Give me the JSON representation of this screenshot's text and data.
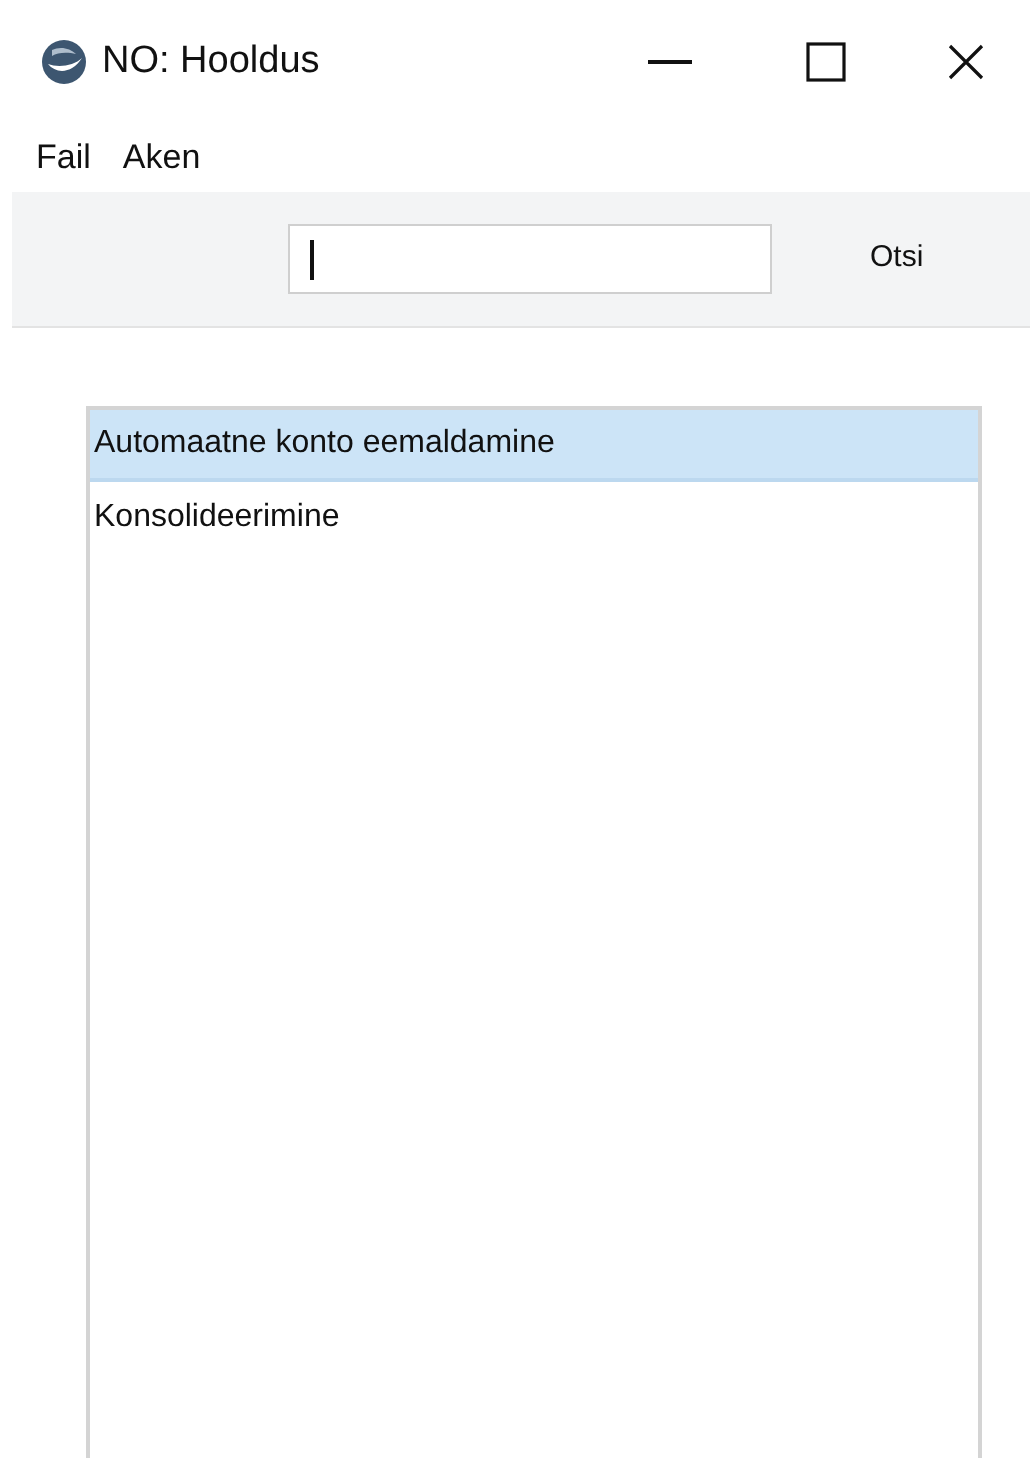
{
  "window": {
    "title": "NO: Hooldus"
  },
  "menu": [
    "Fail",
    "Aken"
  ],
  "toolbar": {
    "search_button": "Otsi",
    "search_focused": true
  },
  "list": [
    {
      "label": "Automaatne konto eemaldamine",
      "selected": true
    },
    {
      "label": "Konsolideerimine",
      "selected": false
    }
  ]
}
